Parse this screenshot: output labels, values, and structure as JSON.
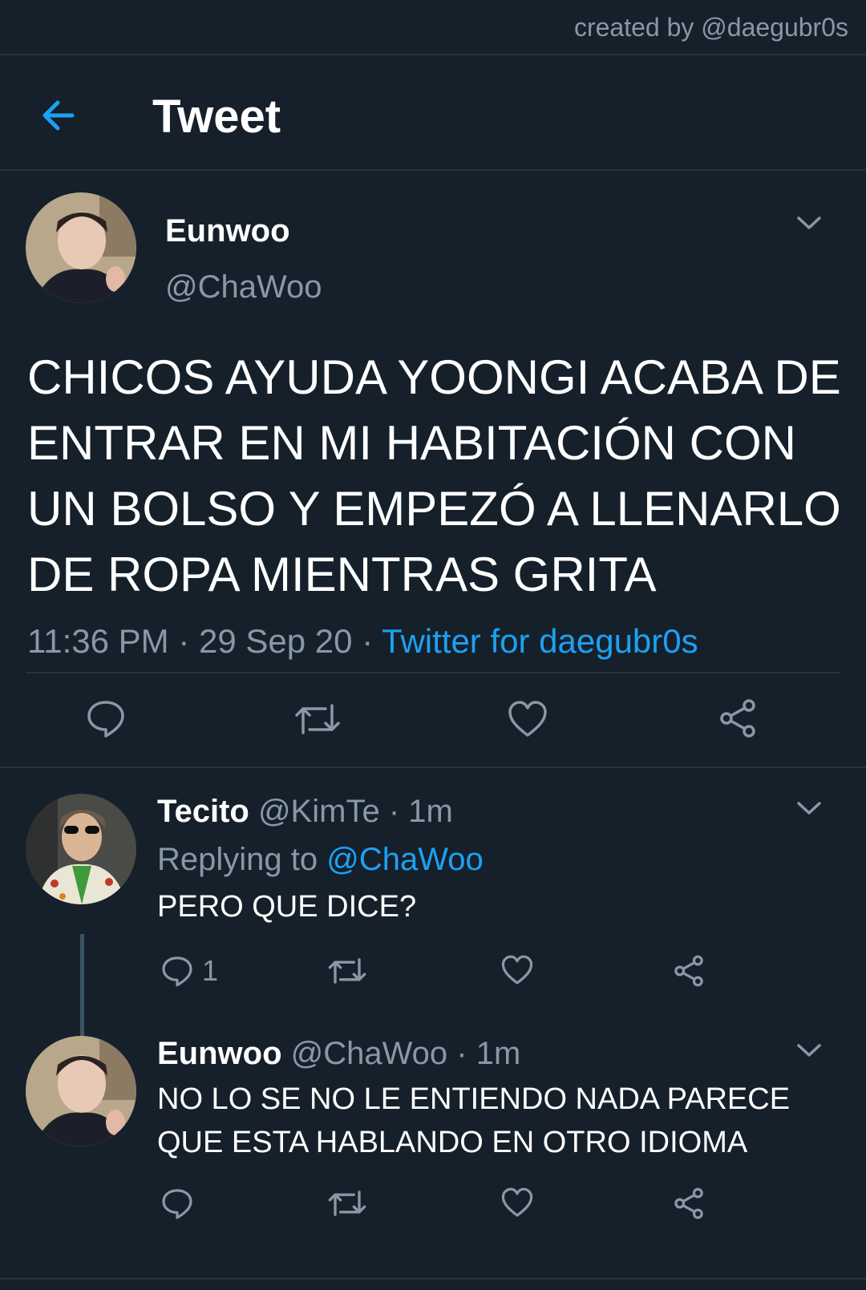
{
  "credit": "created by @daegubr0s",
  "header": {
    "title": "Tweet",
    "back_icon": "arrow-left-icon"
  },
  "colors": {
    "background": "#15202b",
    "accent": "#1da1f2",
    "muted": "#8899a6",
    "divider": "#253341"
  },
  "main_tweet": {
    "name": "Eunwoo",
    "handle": "@ChaWoo",
    "text": "CHICOS AYUDA YOONGI ACABA DE ENTRAR EN MI HABITACIÓN CON UN BOLSO Y EMPEZÓ A LLENARLO DE ROPA MIENTRAS GRITA",
    "time": "11:36 PM",
    "date": "29 Sep 20",
    "source": "Twitter for daegubr0s",
    "separator": "·"
  },
  "replies": [
    {
      "name": "Tecito",
      "handle": "@KimTe",
      "age": "1m",
      "replying_label": "Replying to",
      "replying_to": "@ChaWoo",
      "text": "PERO QUE DICE?",
      "reply_count": "1"
    },
    {
      "name": "Eunwoo",
      "handle": "@ChaWoo",
      "age": "1m",
      "text": "NO LO SE NO LE ENTIENDO NADA PARECE QUE ESTA HABLANDO EN OTRO IDIOMA"
    }
  ]
}
